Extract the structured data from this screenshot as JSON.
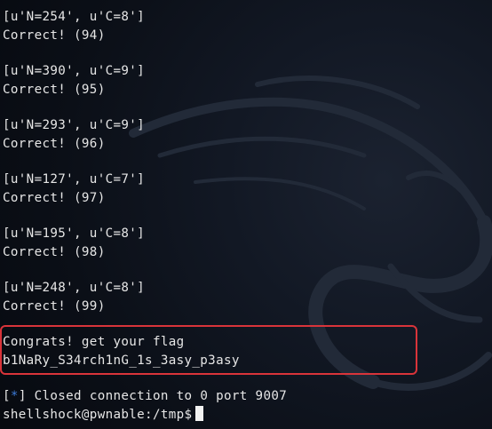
{
  "terminal": {
    "rounds": [
      {
        "query": "[u'N=254', u'C=8']",
        "result": "Correct! (94)"
      },
      {
        "query": "[u'N=390', u'C=9']",
        "result": "Correct! (95)"
      },
      {
        "query": "[u'N=293', u'C=9']",
        "result": "Correct! (96)"
      },
      {
        "query": "[u'N=127', u'C=7']",
        "result": "Correct! (97)"
      },
      {
        "query": "[u'N=195', u'C=8']",
        "result": "Correct! (98)"
      },
      {
        "query": "[u'N=248', u'C=8']",
        "result": "Correct! (99)"
      }
    ],
    "congrats": "Congrats! get your flag",
    "flag": "b1NaRy_S34rch1nG_1s_3asy_p3asy",
    "closed_prefix": "[",
    "closed_star": "*",
    "closed_rest": "] Closed connection to 0 port 9007",
    "prompt": "shellshock@pwnable:/tmp$",
    "colors": {
      "background": "#0b0f17",
      "text": "#e6e6e6",
      "highlight_box": "#d9343a",
      "star": "#3d7bd9"
    },
    "background_icon": "kali-dragon-icon"
  }
}
